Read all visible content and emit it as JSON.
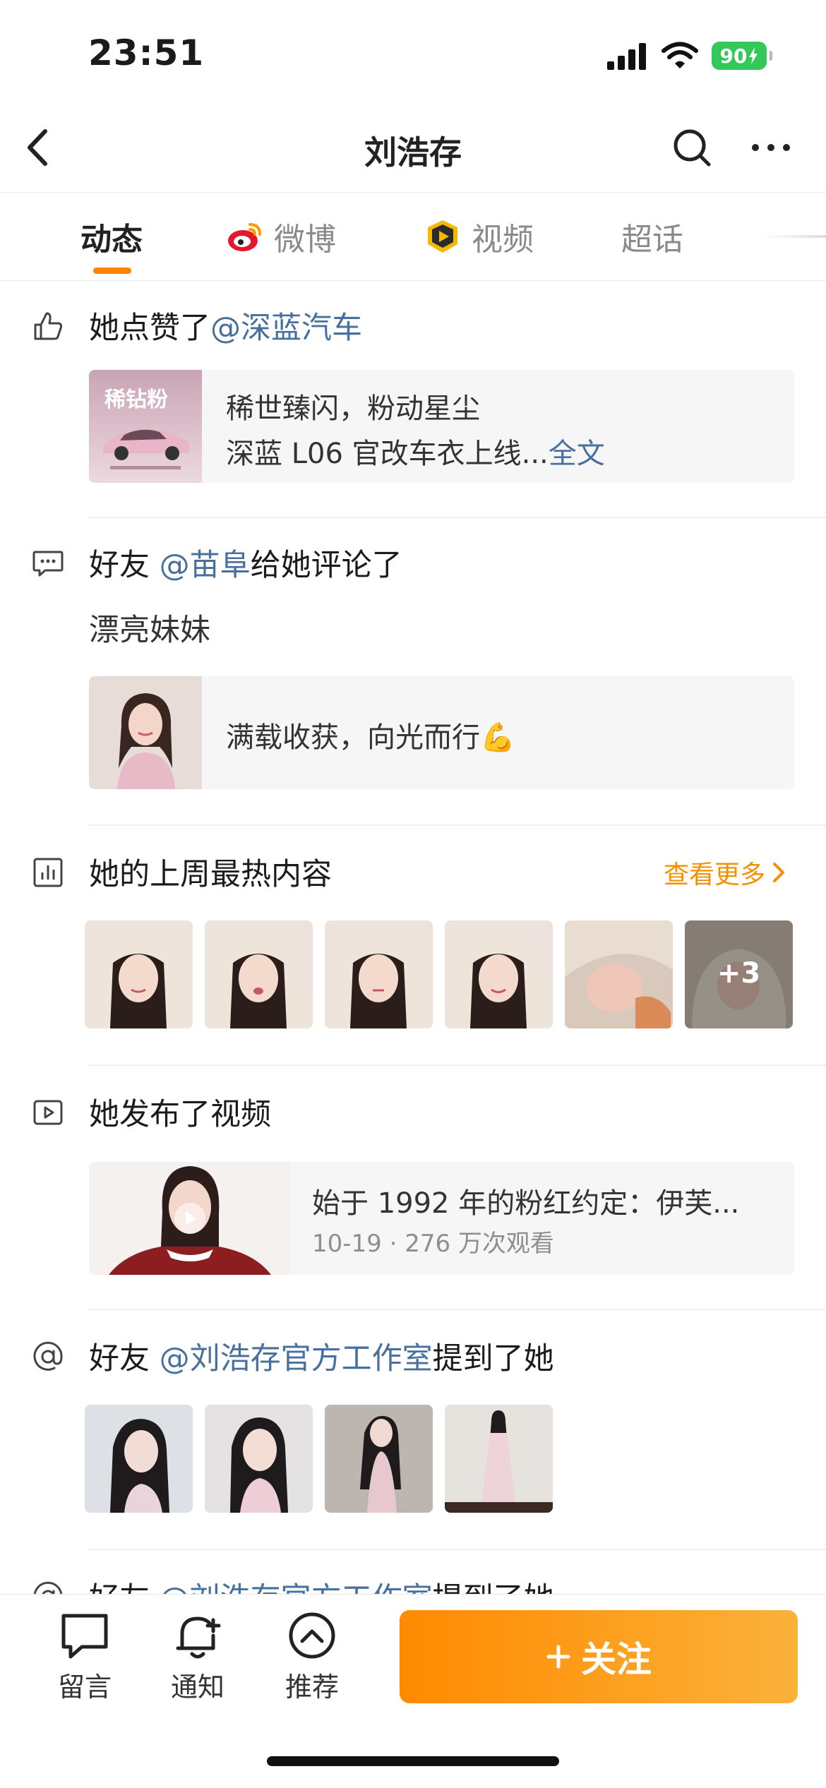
{
  "status_bar": {
    "time": "23:51",
    "battery": "90"
  },
  "nav": {
    "title": "刘浩存"
  },
  "tabs": [
    {
      "label": "动态"
    },
    {
      "label": "微博"
    },
    {
      "label": "视频"
    },
    {
      "label": "超话"
    }
  ],
  "feed": {
    "like": {
      "prefix": "她点赞了",
      "mention": "@深蓝汽车",
      "card": {
        "thumb_text": "稀钻粉",
        "line1": "稀世臻闪，粉动星尘",
        "line2": "深蓝 L06 官改车衣上线...",
        "full_text": "全文"
      }
    },
    "comment": {
      "prefix": "好友 ",
      "mention": "@苗阜",
      "suffix": "给她评论了",
      "body": "漂亮妹妹",
      "card": {
        "line1": "满载收获，向光而行💪"
      }
    },
    "hot": {
      "title": "她的上周最热内容",
      "see_more": "查看更多",
      "more_count": "+3"
    },
    "video": {
      "title": "她发布了视频",
      "card": {
        "line1": "始于 1992 年的粉红约定：伊芙...",
        "meta": "10-19 · 276 万次观看"
      }
    },
    "mention": {
      "prefix": "好友 ",
      "mention": "@刘浩存官方工作室",
      "suffix": "提到了她"
    },
    "mention2": {
      "prefix": "好友 ",
      "mention": "@刘浩存官方工作室",
      "suffix": "提到了她"
    }
  },
  "bottom_bar": {
    "items": [
      {
        "label": "留言",
        "icon": "message-icon"
      },
      {
        "label": "通知",
        "icon": "bell-plus-icon"
      },
      {
        "label": "推荐",
        "icon": "chevron-up-circle-icon"
      }
    ],
    "follow": "关注"
  },
  "colors": {
    "accent": "#ff8200",
    "link": "#48709e",
    "see_more": "#f29100",
    "battery": "#34c759"
  }
}
